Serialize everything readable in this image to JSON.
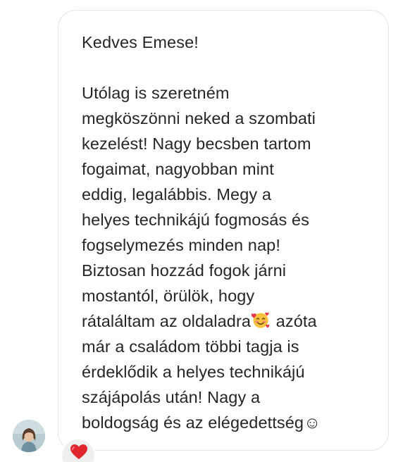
{
  "message": {
    "greeting": "Kedves Emese!",
    "lines": [
      "Utólag is szeretném",
      "megköszönni neked a szombati",
      "kezelést! Nagy becsben tartom",
      "fogaimat, nagyobban mint",
      "eddig, legalábbis. Megy a",
      "helyes technikájú fogmosás és",
      "fogselymezés minden nap!",
      "Biztosan hozzád fogok járni",
      "mostantól, örülök, hogy"
    ],
    "line_with_emoji_before": "rátaláltam az oldaladra",
    "line_with_emoji_after": " azóta",
    "lines_after": [
      "már a családom többi tagja is",
      "érdeklődik a helyes technikájú",
      "szájápolás után! Nagy a"
    ],
    "last_line": "boldogság és az elégedettség",
    "last_line_emoji": "☺"
  },
  "icons": {
    "inline_emoji": "smiling-face-with-hearts-icon",
    "reaction": "red-heart-icon",
    "avatar": "user-avatar"
  },
  "colors": {
    "text": "#262626",
    "bubble_border": "#e4e4e4",
    "reaction_bg": "#efefef",
    "heart": "#e0252f"
  }
}
